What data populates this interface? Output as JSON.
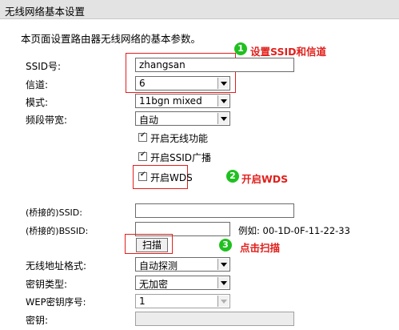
{
  "header": {
    "title": "无线网络基本设置"
  },
  "description": "本页面设置路由器无线网络的基本参数。",
  "fields": {
    "ssid": {
      "label": "SSID号:",
      "value": "zhangsan"
    },
    "channel": {
      "label": "信道:",
      "value": "6"
    },
    "mode": {
      "label": "模式:",
      "value": "11bgn mixed"
    },
    "bandwidth": {
      "label": "频段带宽:",
      "value": "自动"
    },
    "bridge_ssid": {
      "label": "(桥接的)SSID:",
      "value": ""
    },
    "bridge_bssid": {
      "label": "(桥接的)BSSID:",
      "value": "",
      "example": "例如: 00-1D-0F-11-22-33"
    },
    "addr_format": {
      "label": "无线地址格式:",
      "value": "自动探测"
    },
    "key_type": {
      "label": "密钥类型:",
      "value": "无加密"
    },
    "wep_index": {
      "label": "WEP密钥序号:",
      "value": "1"
    },
    "key": {
      "label": "密钥:",
      "value": ""
    }
  },
  "checkboxes": {
    "wireless": {
      "label": "开启无线功能",
      "checked": true
    },
    "ssid_broadcast": {
      "label": "开启SSID广播",
      "checked": true
    },
    "wds": {
      "label": "开启WDS",
      "checked": true
    }
  },
  "scan_button": "扫描",
  "annotations": {
    "a1": {
      "num": "1",
      "text": "设置SSID和信道"
    },
    "a2": {
      "num": "2",
      "text": "开启WDS"
    },
    "a3": {
      "num": "3",
      "text": "点击扫描"
    }
  },
  "colors": {
    "annotation_red": "#e0201c",
    "badge_green": "#20c020",
    "header_bg": "#e3e3e3"
  }
}
